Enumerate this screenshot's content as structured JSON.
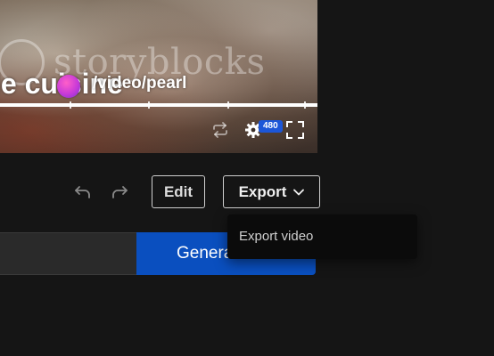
{
  "video": {
    "watermark": "storyblocks",
    "caption_large": "le cuisine",
    "caption_small": "/video/pearl",
    "progress_percent": 100,
    "quality_badge": "480"
  },
  "toolbar": {
    "edit_label": "Edit",
    "export_label": "Export"
  },
  "export_menu": {
    "items": [
      "Export video"
    ]
  },
  "generate": {
    "label": "Generate →"
  },
  "colors": {
    "background": "#151515",
    "accent": "#0a4fbf",
    "badge": "#1c56d8",
    "menu_bg": "#0b0b0b"
  }
}
